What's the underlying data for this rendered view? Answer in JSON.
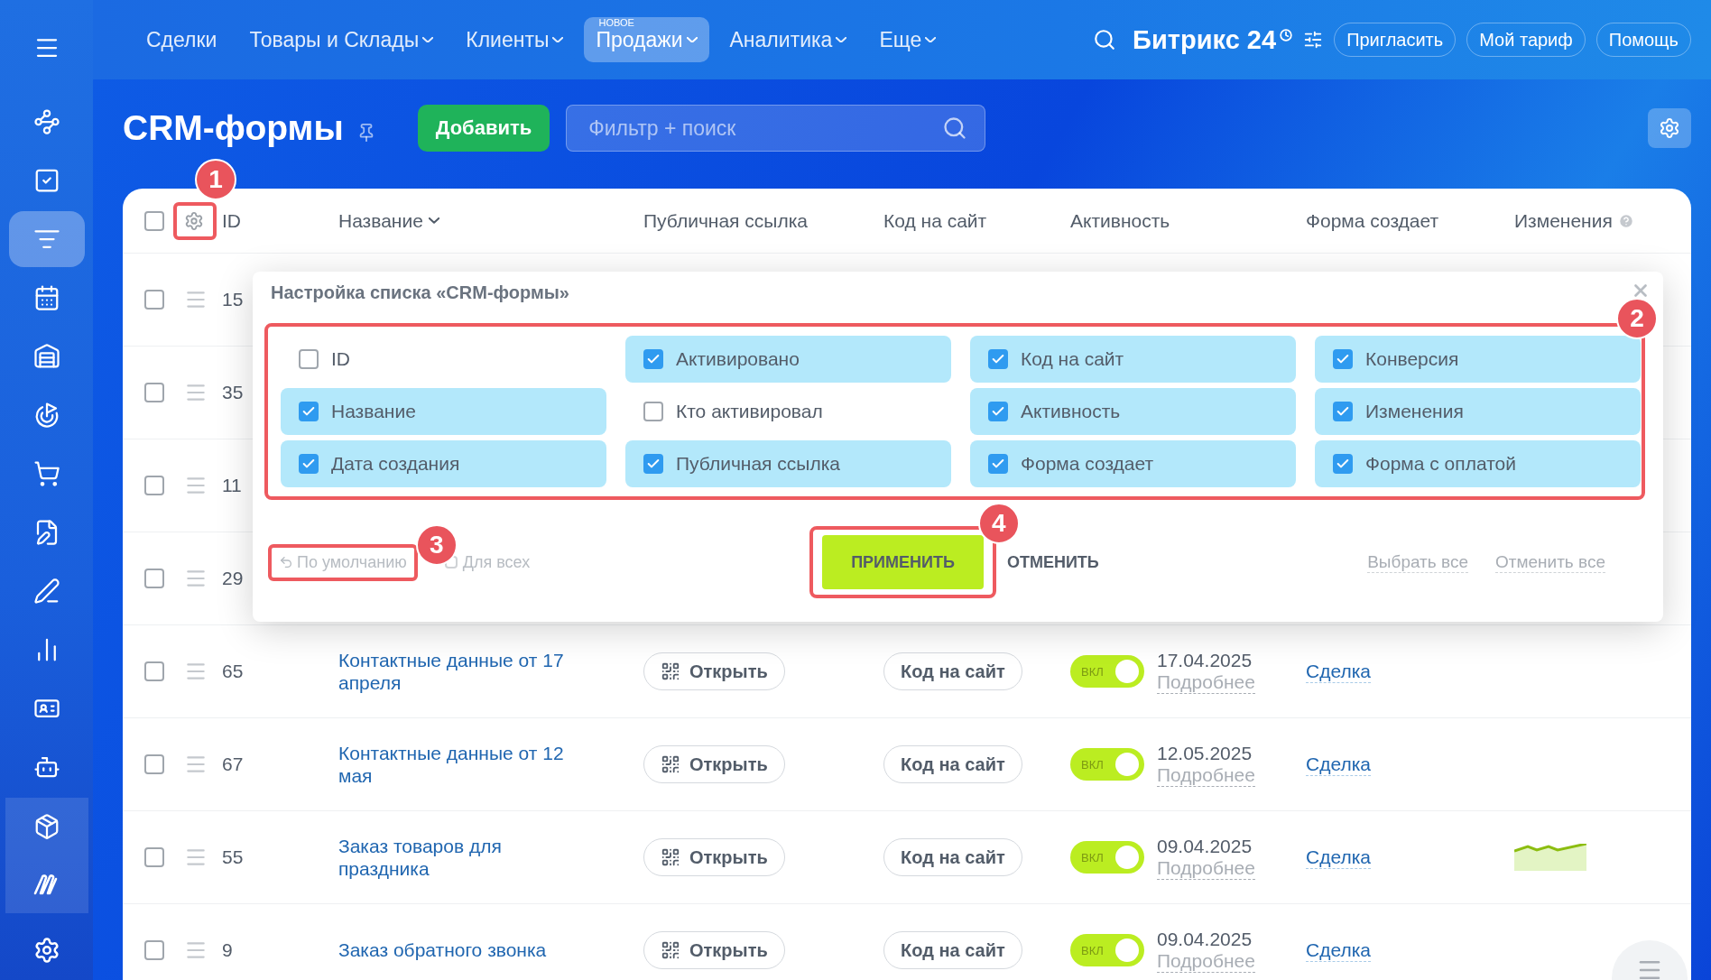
{
  "top_nav": {
    "items": [
      {
        "label": "Сделки",
        "dropdown": false,
        "selected": false
      },
      {
        "label": "Товары и Склады",
        "dropdown": true,
        "selected": false
      },
      {
        "label": "Клиенты",
        "dropdown": true,
        "selected": false
      },
      {
        "label": "Продажи",
        "dropdown": true,
        "selected": true,
        "badge": "НОВОЕ"
      },
      {
        "label": "Аналитика",
        "dropdown": true,
        "selected": false
      },
      {
        "label": "Еще",
        "dropdown": true,
        "selected": false
      }
    ],
    "logo": {
      "name": "Битрикс",
      "suffix": "24"
    },
    "buttons": [
      "Пригласить",
      "Мой тариф",
      "Помощь"
    ]
  },
  "sidebar": {
    "items": [
      {
        "selected": false,
        "grouped": false
      },
      {
        "selected": false,
        "grouped": false
      },
      {
        "selected": false,
        "grouped": false
      },
      {
        "selected": true,
        "grouped": false
      },
      {
        "selected": false,
        "grouped": false
      },
      {
        "selected": false,
        "grouped": false
      },
      {
        "selected": false,
        "grouped": false
      },
      {
        "selected": false,
        "grouped": false
      },
      {
        "selected": false,
        "grouped": false
      },
      {
        "selected": false,
        "grouped": false
      },
      {
        "selected": false,
        "grouped": false
      },
      {
        "selected": false,
        "grouped": false
      },
      {
        "selected": false,
        "grouped": false
      },
      {
        "selected": false,
        "grouped": true
      },
      {
        "selected": false,
        "grouped": true
      },
      {
        "selected": false,
        "grouped": false
      }
    ]
  },
  "page": {
    "title": "CRM-формы",
    "add_button": "Добавить",
    "filter": {
      "placeholder": "Фильтр + поиск"
    }
  },
  "table": {
    "select_all_checked": false,
    "columns": [
      {
        "label": "ID",
        "sortable": false,
        "help": false
      },
      {
        "label": "Название",
        "sortable": true,
        "help": false
      },
      {
        "label": "Публичная ссылка",
        "sortable": false,
        "help": false
      },
      {
        "label": "Код на сайт",
        "sortable": false,
        "help": false
      },
      {
        "label": "Активность",
        "sortable": false,
        "help": false
      },
      {
        "label": "Форма создает",
        "sortable": false,
        "help": false
      },
      {
        "label": "Изменения",
        "sortable": false,
        "help": true
      }
    ],
    "rows": [
      {
        "id": "15",
        "checked": false
      },
      {
        "id": "35",
        "checked": false
      },
      {
        "id": "11",
        "checked": false
      },
      {
        "id": "29",
        "checked": false
      },
      {
        "id": "65",
        "checked": false,
        "name": "Контактные данные от 17 апреля",
        "link": "Открыть",
        "code": "Код на сайт",
        "active": {
          "on": true,
          "label": "ВКЛ"
        },
        "date": "17.04.2025",
        "details": "Подробнее",
        "creates": "Сделка",
        "trend": false
      },
      {
        "id": "67",
        "checked": false,
        "name": "Контактные данные от 12 мая",
        "link": "Открыть",
        "code": "Код на сайт",
        "active": {
          "on": true,
          "label": "ВКЛ"
        },
        "date": "12.05.2025",
        "details": "Подробнее",
        "creates": "Сделка",
        "trend": false
      },
      {
        "id": "55",
        "checked": false,
        "name": "Заказ товаров для праздника",
        "link": "Открыть",
        "code": "Код на сайт",
        "active": {
          "on": true,
          "label": "ВКЛ"
        },
        "date": "09.04.2025",
        "details": "Подробнее",
        "creates": "Сделка",
        "trend": true
      },
      {
        "id": "9",
        "checked": false,
        "name": "Заказ обратного звонка",
        "link": "Открыть",
        "code": "Код на сайт",
        "active": {
          "on": true,
          "label": "ВКЛ"
        },
        "date": "09.04.2025",
        "details": "Подробнее",
        "creates": "Сделка",
        "trend": false
      }
    ]
  },
  "settings_dialog": {
    "title": "Настройка списка «CRM-формы»",
    "options": [
      {
        "label": "ID",
        "checked": false
      },
      {
        "label": "Активировано",
        "checked": true
      },
      {
        "label": "Код на сайт",
        "checked": true
      },
      {
        "label": "Конверсия",
        "checked": true
      },
      {
        "label": "Название",
        "checked": true
      },
      {
        "label": "Кто активировал",
        "checked": false
      },
      {
        "label": "Активность",
        "checked": true
      },
      {
        "label": "Изменения",
        "checked": true
      },
      {
        "label": "Дата создания",
        "checked": true
      },
      {
        "label": "Публичная ссылка",
        "checked": true
      },
      {
        "label": "Форма создает",
        "checked": true
      },
      {
        "label": "Форма с оплатой",
        "checked": true
      }
    ],
    "reset": "По умолчанию",
    "for_all": {
      "label": "Для всех",
      "checked": false
    },
    "apply": "ПРИМЕНИТЬ",
    "cancel": "ОТМЕНИТЬ",
    "select_all": "Выбрать все",
    "deselect_all": "Отменить все"
  },
  "annotations": [
    {
      "number": "1"
    },
    {
      "number": "2"
    },
    {
      "number": "3"
    },
    {
      "number": "4"
    }
  ]
}
